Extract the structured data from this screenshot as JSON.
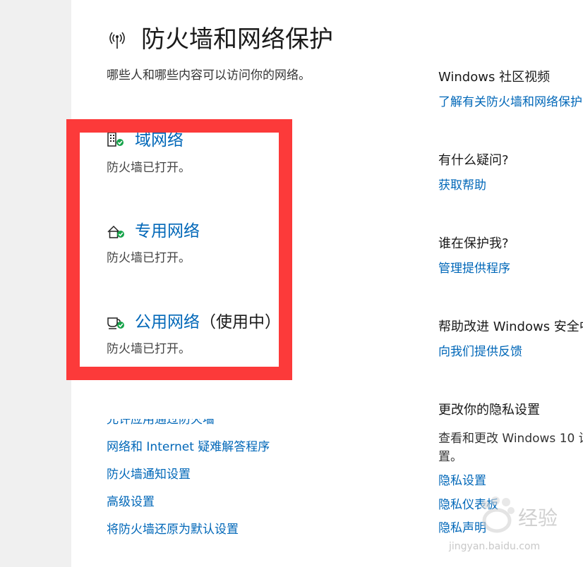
{
  "page": {
    "title": "防火墙和网络保护",
    "subtitle": "哪些人和哪些内容可以访问你的网络。"
  },
  "networks": [
    {
      "name": "域网络",
      "suffix": "",
      "status": "防火墙已打开。",
      "icon": "domain-network-icon"
    },
    {
      "name": "专用网络",
      "suffix": "",
      "status": "防火墙已打开。",
      "icon": "private-network-icon"
    },
    {
      "name": "公用网络",
      "suffix": "（使用中）",
      "status": "防火墙已打开。",
      "icon": "public-network-icon"
    }
  ],
  "links": [
    "允许应用通过防火墙",
    "网络和 Internet 疑难解答程序",
    "防火墙通知设置",
    "高级设置",
    "将防火墙还原为默认设置"
  ],
  "sidebar": {
    "community_heading": "Windows 社区视频",
    "community_link": "了解有关防火墙和网络保护",
    "question_heading": "有什么疑问?",
    "question_link": "获取帮助",
    "protect_heading": "谁在保护我?",
    "protect_link": "管理提供程序",
    "improve_heading": "帮助改进 Windows 安全中",
    "improve_link": "向我们提供反馈",
    "privacy_heading": "更改你的隐私设置",
    "privacy_text": "查看和更改 Windows 10 设置。",
    "privacy_links": [
      "隐私设置",
      "隐私仪表板",
      "隐私声明"
    ]
  },
  "watermark": {
    "brand": "经验",
    "url": "jingyan.baidu.com"
  },
  "colors": {
    "link": "#0067b8",
    "check": "#16a34a",
    "annotation": "#fc3a3a"
  }
}
